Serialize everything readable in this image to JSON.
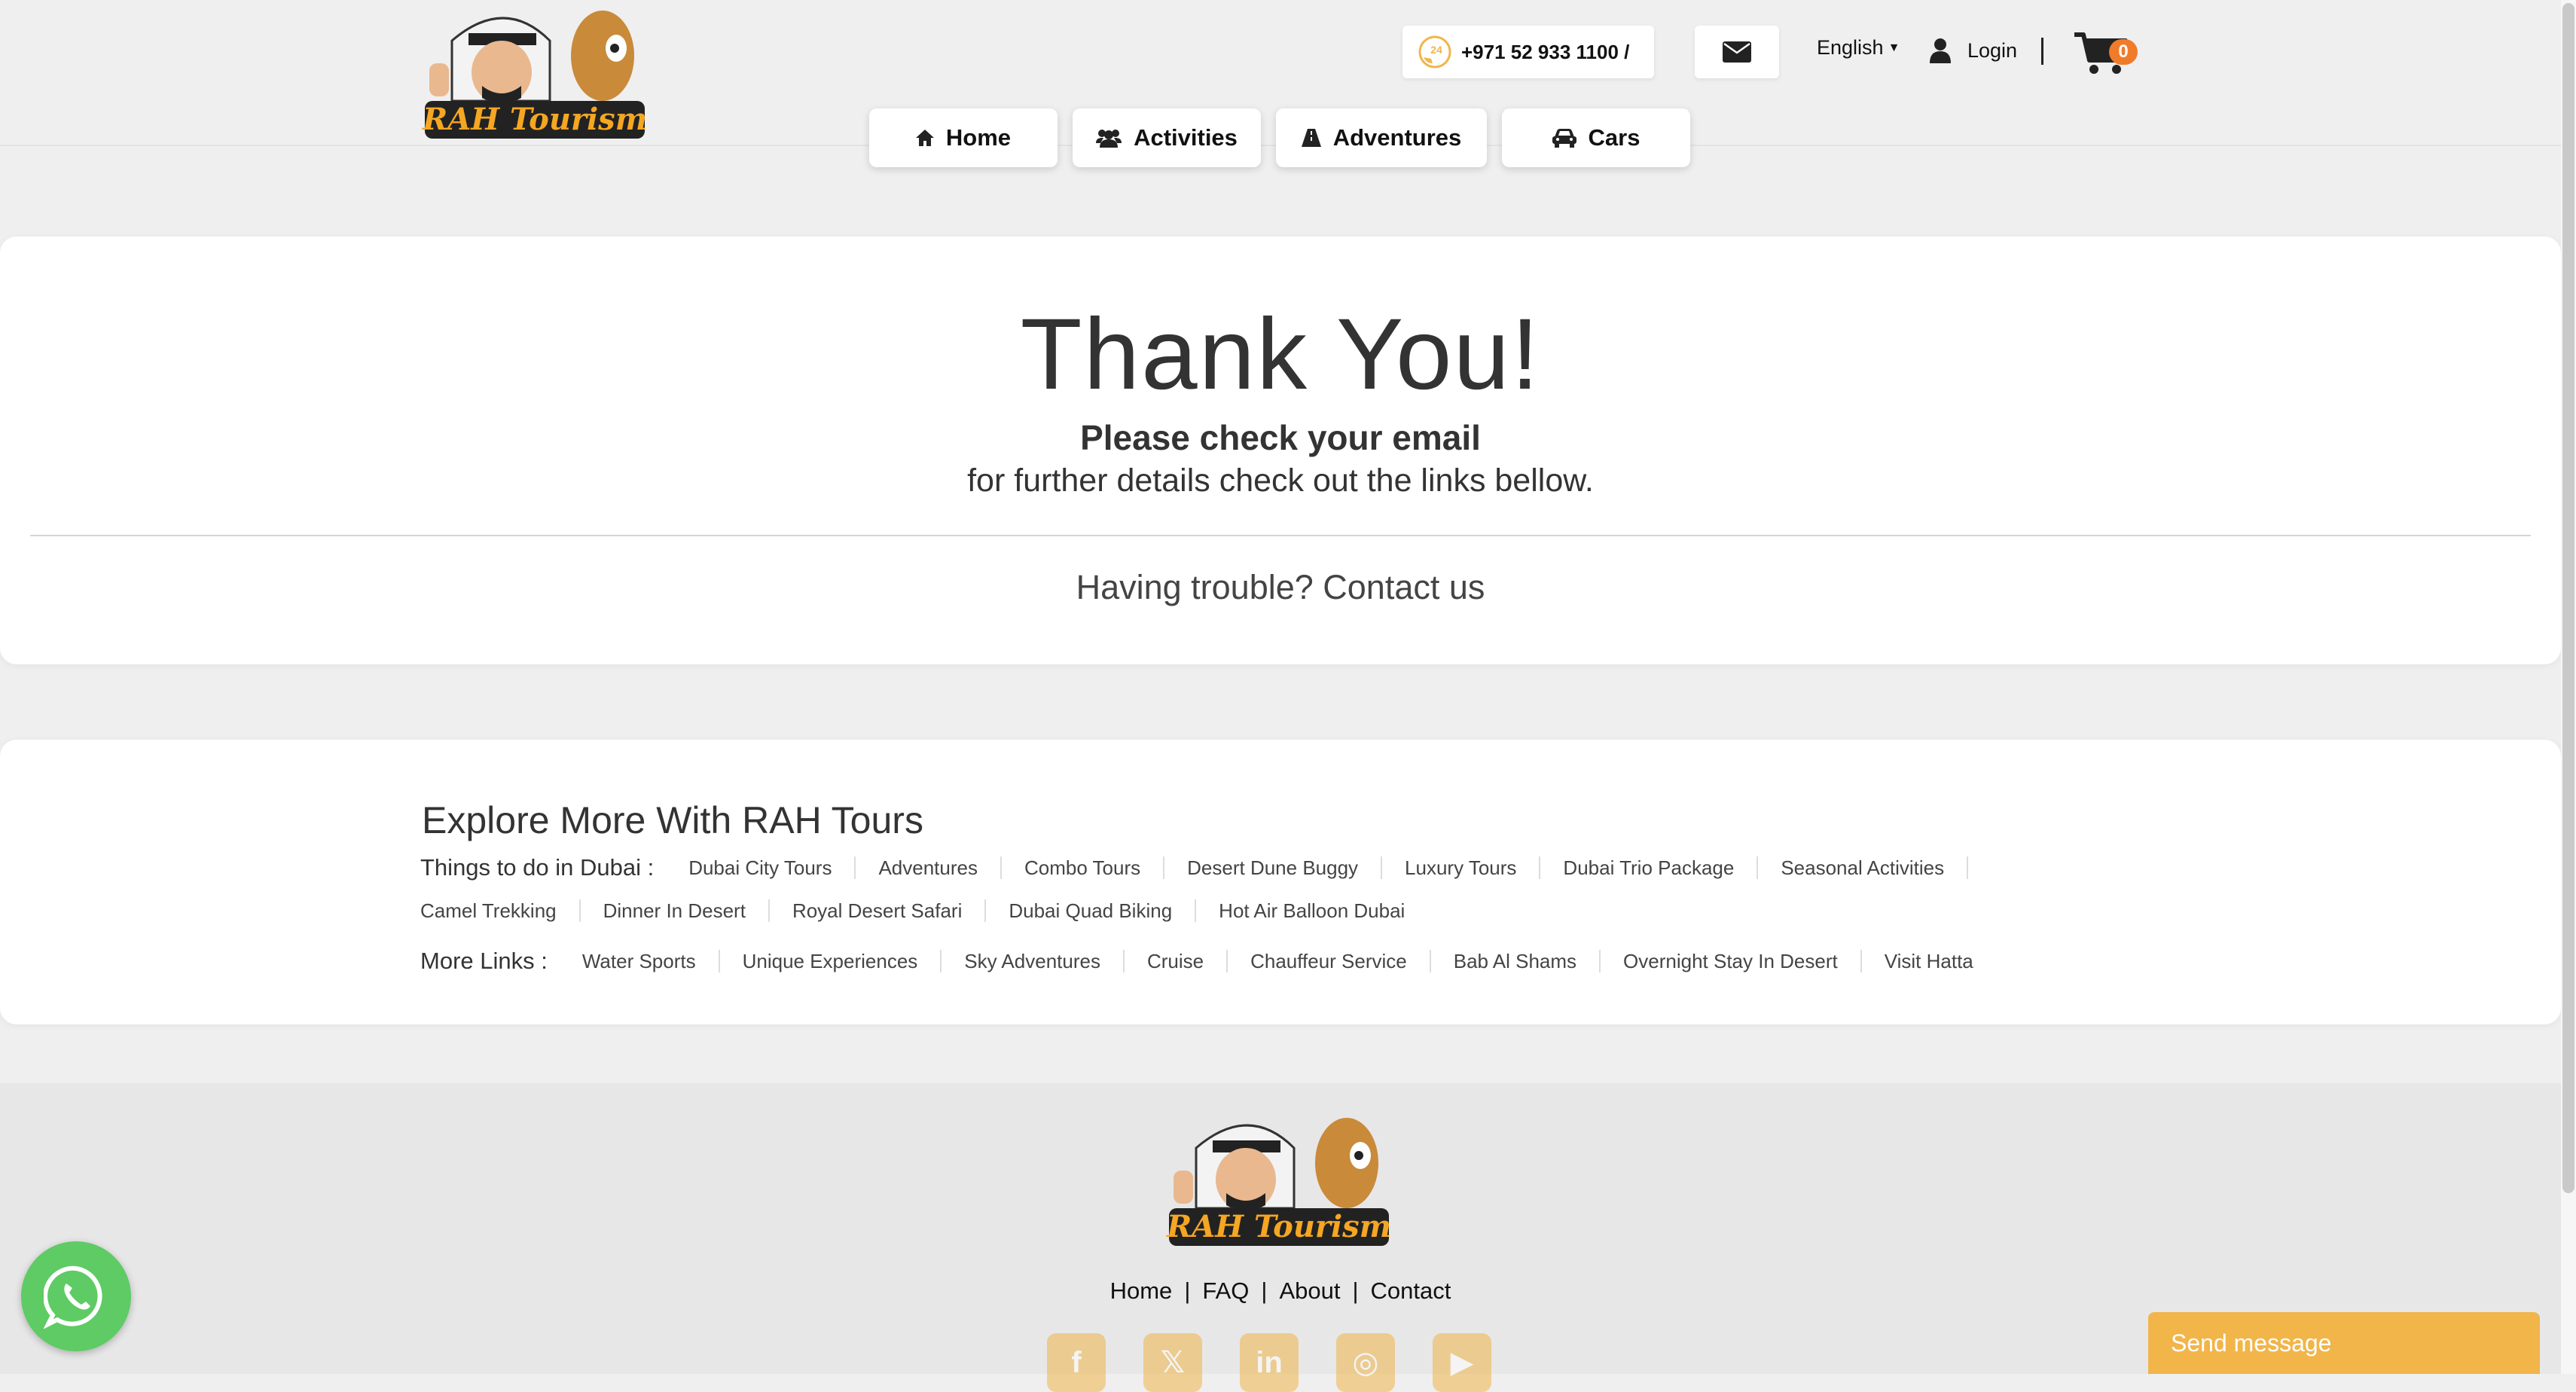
{
  "header": {
    "logo_alt": "RAH Tourism",
    "phone": "+971 52 933 1100  /",
    "language": "English",
    "login_label": "Login",
    "cart_count": "0"
  },
  "nav": [
    {
      "label": "Home",
      "icon": "home-icon"
    },
    {
      "label": "Activities",
      "icon": "users-icon"
    },
    {
      "label": "Adventures",
      "icon": "road-icon"
    },
    {
      "label": "Cars",
      "icon": "car-icon"
    }
  ],
  "thank": {
    "title": "Thank You!",
    "subtitle": "Please check your email",
    "note": "for further details check out the links bellow.",
    "trouble_prefix": "Having trouble? ",
    "trouble_link": "Contact us"
  },
  "explore": {
    "title": "Explore More With RAH Tours",
    "things_label": "Things to do in Dubai :",
    "things_row1": [
      "Dubai City Tours",
      "Adventures",
      "Combo Tours",
      "Desert Dune Buggy",
      "Luxury Tours",
      "Dubai Trio Package",
      "Seasonal Activities"
    ],
    "things_row2": [
      "Camel Trekking",
      "Dinner In Desert",
      "Royal Desert Safari",
      "Dubai Quad Biking",
      "Hot Air Balloon Dubai"
    ],
    "more_label": "More Links :",
    "more_links": [
      "Water Sports",
      "Unique Experiences",
      "Sky Adventures",
      "Cruise",
      "Chauffeur Service",
      "Bab Al Shams",
      "Overnight Stay In Desert",
      "Visit Hatta"
    ]
  },
  "footer": {
    "links": [
      "Home",
      "FAQ",
      "About",
      "Contact"
    ],
    "socials": [
      "facebook-icon",
      "x-icon",
      "linkedin-icon",
      "instagram-icon",
      "youtube-icon"
    ]
  },
  "chat": {
    "send_message": "Send message"
  },
  "colors": {
    "accent": "#f1b54a",
    "badge": "#f07b2b",
    "whatsapp": "#5ecb64"
  }
}
